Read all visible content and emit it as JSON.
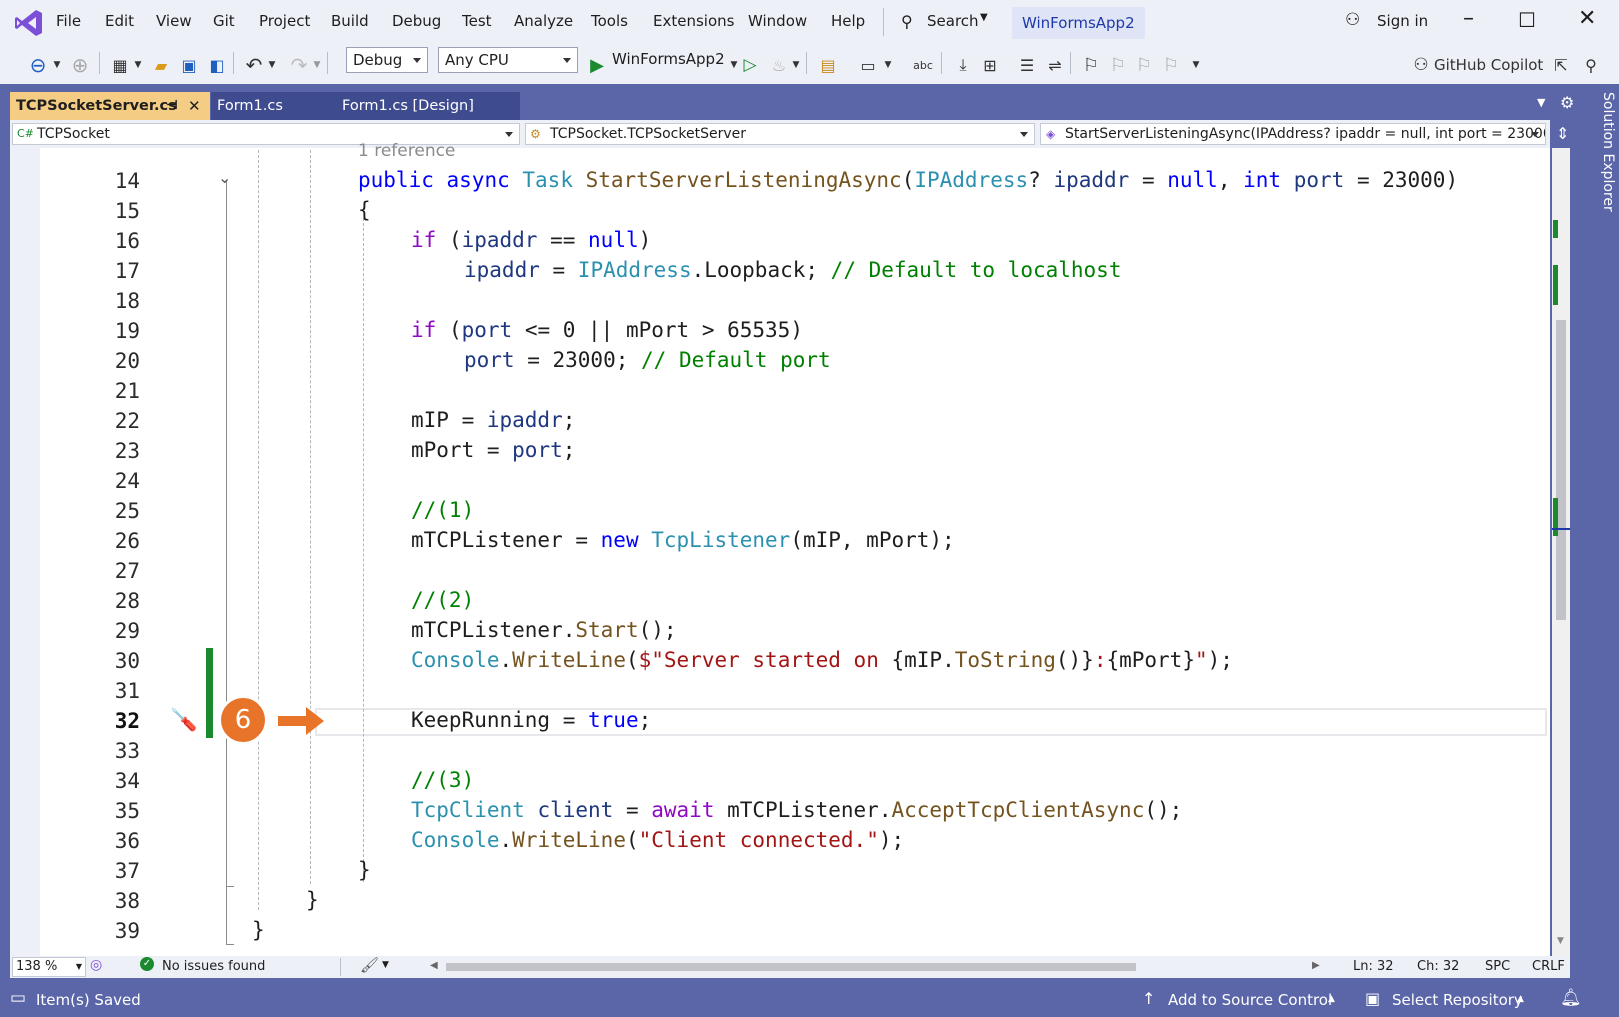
{
  "menu": [
    "File",
    "Edit",
    "View",
    "Git",
    "Project",
    "Build",
    "Debug",
    "Test",
    "Analyze",
    "Tools",
    "Extensions",
    "Window",
    "Help"
  ],
  "search": {
    "label": "Search"
  },
  "solution_name": "WinFormsApp2",
  "sign_in": "Sign in",
  "toolbar": {
    "config": "Debug",
    "platform": "Any CPU",
    "run_target": "WinFormsApp2",
    "copilot": "GitHub Copilot"
  },
  "tabs": [
    {
      "label": "TCPSocketServer.cs",
      "active": true
    },
    {
      "label": "Form1.cs",
      "active": false
    },
    {
      "label": "Form1.cs [Design]",
      "active": false
    }
  ],
  "navbar": {
    "project": "TCPSocket",
    "class": "TCPSocket.TCPSocketServer",
    "member": "StartServerListeningAsync(IPAddress? ipaddr = null, int port = 23000)"
  },
  "solution_explorer": "Solution Explorer",
  "editor": {
    "reference_hint": "1 reference",
    "current_line": 32,
    "lines": [
      "14",
      "15",
      "16",
      "17",
      "18",
      "19",
      "20",
      "21",
      "22",
      "23",
      "24",
      "25",
      "26",
      "27",
      "28",
      "29",
      "30",
      "31",
      "32",
      "33",
      "34",
      "35",
      "36",
      "37",
      "38",
      "39"
    ]
  },
  "code": {
    "l14": {
      "a": "public",
      "b": "async",
      "c": "Task",
      "d": "StartServerListeningAsync",
      "e": "(",
      "f": "IPAddress",
      "g": "? ",
      "h": "ipaddr",
      "i": " = ",
      "j": "null",
      ",": ", ",
      "k": "int",
      "l": "port",
      "m": " = 23000)"
    },
    "l15": "{",
    "l16": {
      "a": "if",
      "b": " (",
      "c": "ipaddr",
      "d": " == ",
      "e": "null",
      "f": ")"
    },
    "l17": {
      "a": "ipaddr",
      "b": " = ",
      "c": "IPAddress",
      "d": ".Loopback; ",
      "e": "// Default to localhost"
    },
    "l19": {
      "a": "if",
      "b": " (",
      "c": "port",
      "d": " <= 0 || mPort > 65535)"
    },
    "l20": {
      "a": "port",
      "b": " = 23000; ",
      "c": "// Default port"
    },
    "l22": {
      "a": "mIP = ",
      "b": "ipaddr",
      "c": ";"
    },
    "l23": {
      "a": "mPort = ",
      "b": "port",
      "c": ";"
    },
    "l25": "//(1)",
    "l26": {
      "a": "mTCPListener = ",
      "b": "new",
      "c": " ",
      "d": "TcpListener",
      "e": "(mIP, mPort);"
    },
    "l28": "//(2)",
    "l29": {
      "a": "mTCPListener.",
      "b": "Start",
      "c": "();"
    },
    "l30": {
      "a": "Console",
      "b": ".",
      "c": "WriteLine",
      "d": "(",
      "e": "$\"Server started on ",
      "f": "{mIP.",
      "g": "ToString",
      "h": "()}",
      "i": ":",
      "j": "{mPort}",
      "k": "\"",
      "l": ");"
    },
    "l32": {
      "a": "KeepRunning = ",
      "b": "true",
      "c": ";"
    },
    "l34": "//(3)",
    "l35": {
      "a": "TcpClient",
      "b": " ",
      "c": "client",
      "d": " = ",
      "e": "await",
      "f": " mTCPListener.",
      "g": "AcceptTcpClientAsync",
      "h": "();"
    },
    "l36": {
      "a": "Console",
      "b": ".",
      "c": "WriteLine",
      "d": "(",
      "e": "\"Client connected.\"",
      "f": ");"
    },
    "l37": "}",
    "l38": "}",
    "l39": "}"
  },
  "callout": "6",
  "edstatus": {
    "zoom": "138 %",
    "issues": "No issues found",
    "ln": "Ln: 32",
    "ch": "Ch: 32",
    "spc": "SPC",
    "crlf": "CRLF"
  },
  "statusbar": {
    "saved": "Item(s) Saved",
    "source_control": "Add to Source Control",
    "repo": "Select Repository"
  },
  "colors": {
    "accent": "#5b66a8",
    "tab_active": "#f5cc84",
    "callout": "#e8742a",
    "change_bar": "#1b8a2e"
  }
}
